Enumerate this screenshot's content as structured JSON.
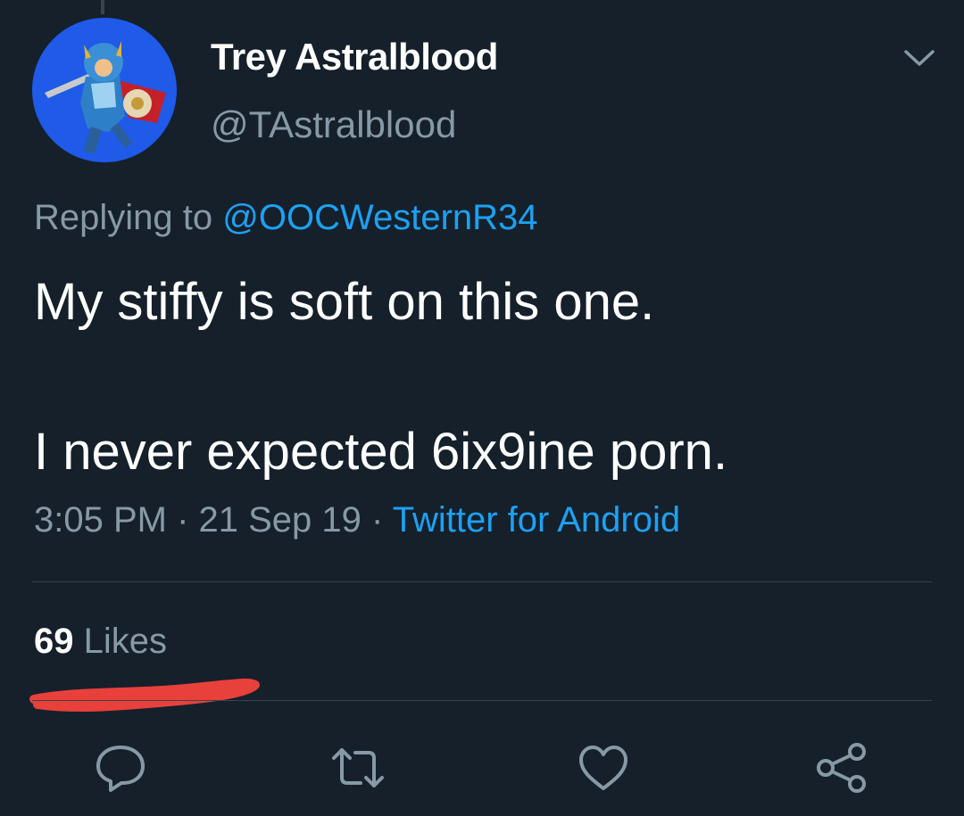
{
  "tweet": {
    "display_name": "Trey Astralblood",
    "handle": "@TAstralblood",
    "replying_prefix": "Replying to",
    "replying_to": "@OOCWesternR34",
    "text_line_1": "My stiffy is soft on this one.",
    "text_line_2": "I never expected 6ix9ine porn.",
    "time": "3:05 PM",
    "date": "21 Sep 19",
    "source": "Twitter for Android",
    "separator": " · ",
    "likes_count": "69",
    "likes_label": "Likes"
  },
  "icons": {
    "caret": "chevron-down-icon",
    "reply": "reply-icon",
    "retweet": "retweet-icon",
    "like": "heart-icon",
    "share": "share-icon"
  },
  "colors": {
    "background": "#15202b",
    "text": "#ffffff",
    "muted": "#8899a6",
    "link": "#1da1f2",
    "divider": "#38444d",
    "annotation": "#e8403a"
  }
}
